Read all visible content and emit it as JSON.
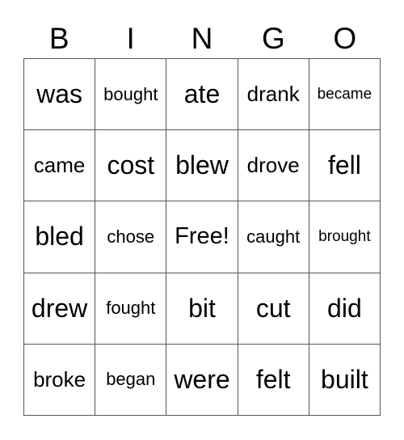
{
  "header": [
    "B",
    "I",
    "N",
    "G",
    "O"
  ],
  "cells": [
    [
      "was",
      "bought",
      "ate",
      "drank",
      "became"
    ],
    [
      "came",
      "cost",
      "blew",
      "drove",
      "fell"
    ],
    [
      "bled",
      "chose",
      "Free!",
      "caught",
      "brought"
    ],
    [
      "drew",
      "fought",
      "bit",
      "cut",
      "did"
    ],
    [
      "broke",
      "began",
      "were",
      "felt",
      "built"
    ]
  ]
}
